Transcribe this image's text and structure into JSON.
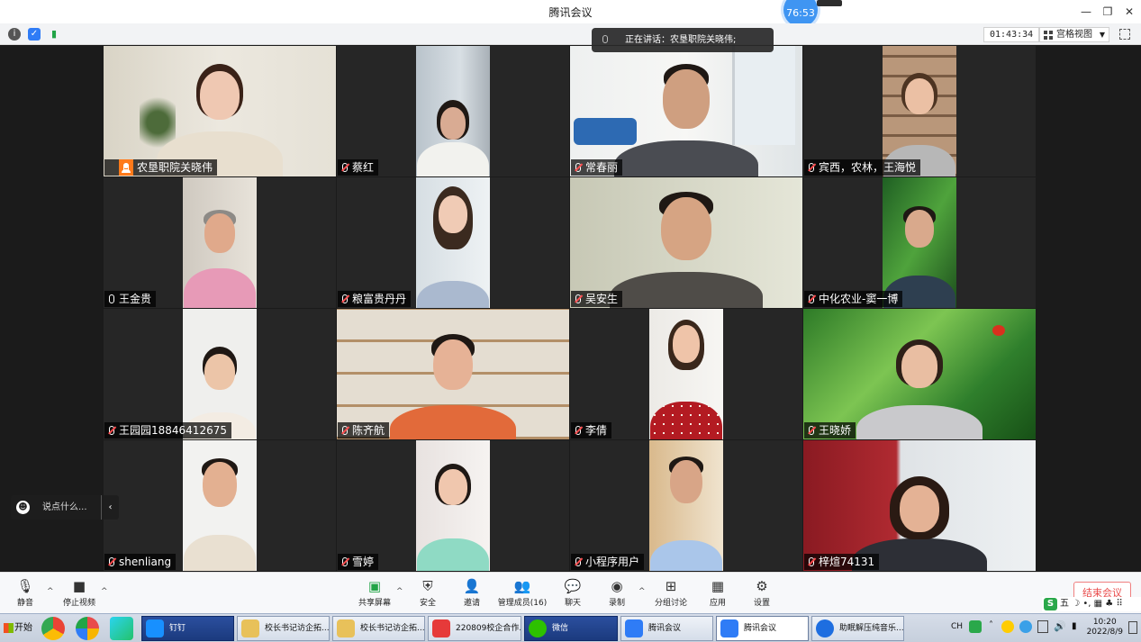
{
  "window": {
    "title": "腾讯会议",
    "badge": "76:53"
  },
  "infobar": {
    "timer": "01:43:34",
    "view_label": "宫格视图"
  },
  "speaking": {
    "text": "正在讲话：农垦职院关晓伟;"
  },
  "participants": [
    {
      "name": "农垦职院关晓伟",
      "mic": "on",
      "host": true
    },
    {
      "name": "蔡红",
      "mic": "off"
    },
    {
      "name": "常春丽",
      "mic": "off"
    },
    {
      "name": "宾西，农林，王海悦",
      "mic": "off"
    },
    {
      "name": "王金贵",
      "mic": "on"
    },
    {
      "name": "粮富贵丹丹",
      "mic": "off"
    },
    {
      "name": "吴安生",
      "mic": "off"
    },
    {
      "name": "中化农业-窦一博",
      "mic": "off"
    },
    {
      "name": "王园园18846412675",
      "mic": "off"
    },
    {
      "name": "陈齐航",
      "mic": "off"
    },
    {
      "name": "李倩",
      "mic": "off"
    },
    {
      "name": "王晓娇",
      "mic": "off"
    },
    {
      "name": "shenliang",
      "mic": "off"
    },
    {
      "name": "雪婷",
      "mic": "off"
    },
    {
      "name": "小程序用户",
      "mic": "off"
    },
    {
      "name": "梓煊74131",
      "mic": "off"
    }
  ],
  "chat": {
    "placeholder": "说点什么..."
  },
  "toolbar": {
    "mute": "静音",
    "stop_video": "停止视频",
    "share_screen": "共享屏幕",
    "security": "安全",
    "invite": "邀请",
    "manage_members": "管理成员(16)",
    "chat": "聊天",
    "record": "录制",
    "breakout": "分组讨论",
    "apps": "应用",
    "settings": "设置",
    "end_meeting": "结束会议"
  },
  "ime": {
    "text": "五 ☽ •, ▦ ♣ ⠿"
  },
  "taskbar": {
    "start": "开始",
    "tasks": [
      "钉钉",
      "校长书记访企拓...",
      "校长书记访企拓...",
      "220809校企合作...",
      "微信",
      "腾讯会议",
      "腾讯会议",
      "助眠解压纯音乐..."
    ],
    "lang": "CH",
    "time": "10:20",
    "date": "2022/8/9"
  },
  "colors": {
    "accent": "#3f95f2",
    "active_border": "#27b54f",
    "end": "#e94b4b",
    "host": "#ff7a1a"
  }
}
